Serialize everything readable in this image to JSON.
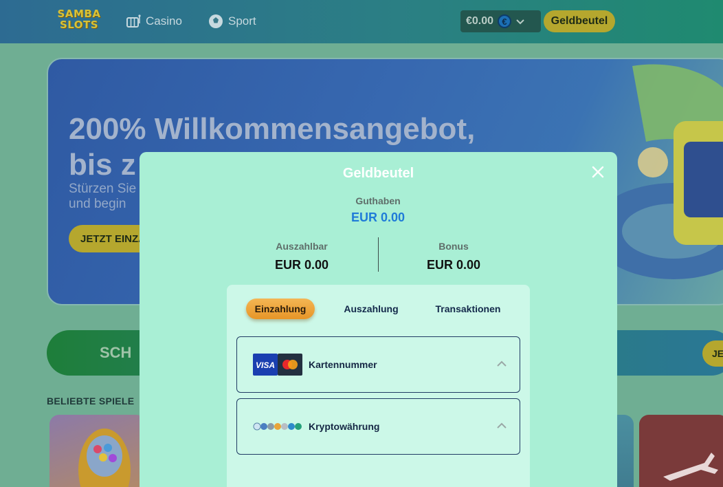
{
  "topbar": {
    "logo_line1": "SAMBA",
    "logo_line2": "SLOTS",
    "nav": [
      {
        "label": "Casino",
        "icon": "casino-icon"
      },
      {
        "label": "Sport",
        "icon": "sport-icon"
      }
    ],
    "balance": "€0.00",
    "currency_symbol": "€",
    "wallet_label": "Geldbeutel"
  },
  "hero": {
    "title_line1": "200% Willkommensangebot,",
    "title_line2": "bis z",
    "subtitle_line1": "Stürzen Sie",
    "subtitle_line2": "und begin",
    "cta_label": "JETZT EINZA"
  },
  "promo": {
    "text": "SCH",
    "button_label": "JE"
  },
  "section": {
    "popular_games_title": "BELIEBTE SPIELE"
  },
  "modal": {
    "title": "Geldbeutel",
    "balance_label": "Guthaben",
    "balance_value": "EUR 0.00",
    "withdrawable_label": "Auszahlbar",
    "withdrawable_value": "EUR 0.00",
    "bonus_label": "Bonus",
    "bonus_value": "EUR 0.00",
    "tabs": [
      {
        "label": "Einzahlung",
        "active": true
      },
      {
        "label": "Auszahlung",
        "active": false
      },
      {
        "label": "Transaktionen",
        "active": false
      }
    ],
    "methods": [
      {
        "label": "Kartennummer",
        "icon": "visa-mastercard-icon"
      },
      {
        "label": "Kryptowährung",
        "icon": "crypto-coins-icon"
      }
    ]
  },
  "colors": {
    "accent_gold": "#b5a72e",
    "active_tab": "#e79527",
    "balance_blue": "#1f7bd8",
    "modal_bg": "#a9efd5"
  }
}
